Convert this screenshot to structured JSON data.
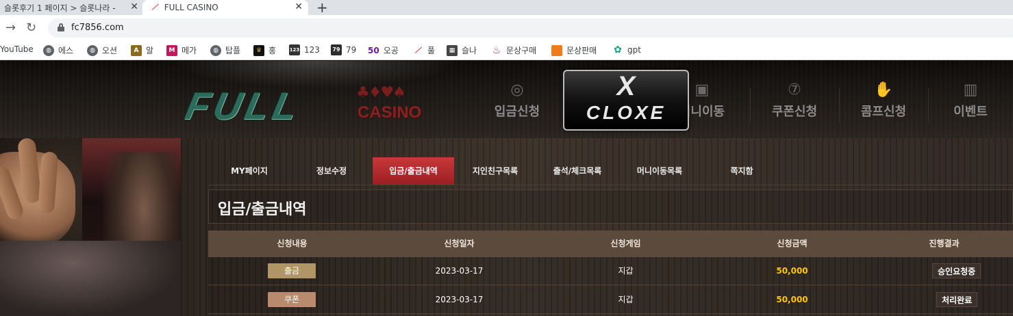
{
  "browser": {
    "tabs": [
      {
        "title": "슬롯후기 1 페이지 > 슬롯나라 -"
      },
      {
        "title": "FULL CASINO"
      }
    ],
    "url": "fc7856.com",
    "bookmarks": [
      {
        "label": "YouTube",
        "icon": "youtube-icon"
      },
      {
        "label": "에스",
        "icon": "globe-icon"
      },
      {
        "label": "오션",
        "icon": "globe-icon"
      },
      {
        "label": "알",
        "icon": "casino-logo-icon"
      },
      {
        "label": "메가",
        "icon": "mega-icon"
      },
      {
        "label": "탑플",
        "icon": "globe-icon"
      },
      {
        "label": "홍",
        "icon": "crown-icon"
      },
      {
        "label": "123",
        "icon": "number-123-icon"
      },
      {
        "label": "79",
        "icon": "number-79-icon"
      },
      {
        "label": "오공",
        "icon": "fifty-icon"
      },
      {
        "label": "풀",
        "icon": "full-casino-icon"
      },
      {
        "label": "슬나",
        "icon": "film-icon"
      },
      {
        "label": "문상구매",
        "icon": "danawa-icon"
      },
      {
        "label": "문상판매",
        "icon": "orange-square-icon"
      },
      {
        "label": "gpt",
        "icon": "openai-icon"
      }
    ]
  },
  "site": {
    "logo": {
      "word": "FULL",
      "suits": "♣♦♥♠",
      "sub": "CASINO"
    },
    "topnav": [
      {
        "label": "입금신청",
        "icon": "coin-icon"
      },
      {
        "label": "머니이동",
        "icon": "wallet-icon"
      },
      {
        "label": "쿠폰신청",
        "icon": "slot-seven-icon"
      },
      {
        "label": "콤프신청",
        "icon": "hand-coin-icon"
      },
      {
        "label": "이벤트",
        "icon": "gift-icon"
      }
    ],
    "overlay": {
      "line1": "X",
      "line2": "CLOXE"
    },
    "subnav": [
      {
        "label": "MY페이지",
        "active": false
      },
      {
        "label": "정보수정",
        "active": false
      },
      {
        "label": "입금/출금내역",
        "active": true
      },
      {
        "label": "지인친구목록",
        "active": false
      },
      {
        "label": "출석/체크목록",
        "active": false
      },
      {
        "label": "머니이동목록",
        "active": false
      },
      {
        "label": "쪽지함",
        "active": false
      }
    ],
    "page_title": "입금/출금내역",
    "table": {
      "headers": [
        "신청내용",
        "신청일자",
        "신청게임",
        "신청금액",
        "진행결과"
      ],
      "rows": [
        {
          "type": "출금",
          "type_color": "#b09567",
          "date": "2023-03-17",
          "game": "지갑",
          "amount": "50,000",
          "status": "승인요청중"
        },
        {
          "type": "쿠폰",
          "type_color": "#b98a6e",
          "date": "2023-03-17",
          "game": "지갑",
          "amount": "50,000",
          "status": "처리완료"
        }
      ]
    }
  }
}
